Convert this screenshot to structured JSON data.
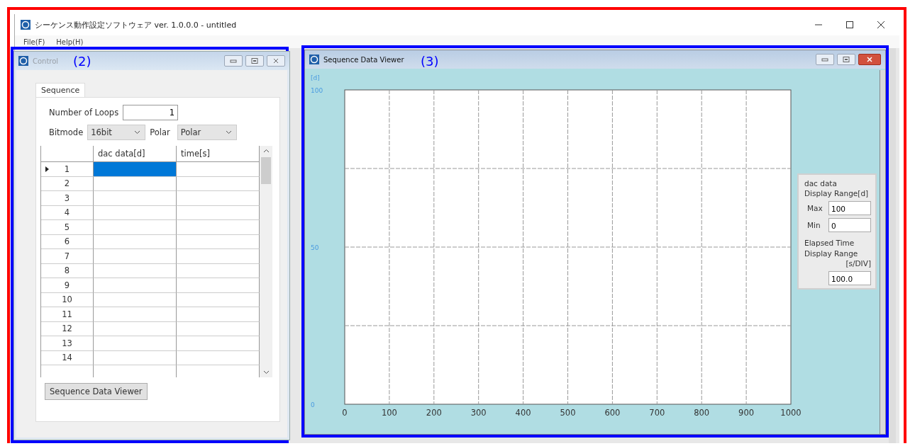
{
  "window": {
    "title": "シーケンス動作設定ソフトウェア ver. 1.0.0.0 - untitled"
  },
  "menu": [
    "File(F)",
    "Help(H)"
  ],
  "control": {
    "title": "Control",
    "active": false,
    "annotation": "(2)",
    "tabs": [
      {
        "label": "Sequence",
        "selected": true
      }
    ],
    "loops": {
      "label": "Number of Loops",
      "value": "1"
    },
    "bitmode": {
      "label": "Bitmode",
      "value": "16bit"
    },
    "polar": {
      "label": "Polar",
      "value": "Polar"
    },
    "table": {
      "columns": [
        "dac data[d]",
        "time[s]"
      ],
      "rows": [
        {
          "number": "1",
          "selected": true
        },
        {
          "number": "2",
          "selected": false
        },
        {
          "number": "3",
          "selected": false
        },
        {
          "number": "4",
          "selected": false
        },
        {
          "number": "5",
          "selected": false
        },
        {
          "number": "6",
          "selected": false
        },
        {
          "number": "7",
          "selected": false
        },
        {
          "number": "8",
          "selected": false
        },
        {
          "number": "9",
          "selected": false
        },
        {
          "number": "10",
          "selected": false
        },
        {
          "number": "11",
          "selected": false
        },
        {
          "number": "12",
          "selected": false
        },
        {
          "number": "13",
          "selected": false
        },
        {
          "number": "14",
          "selected": false
        }
      ]
    },
    "button": "Sequence Data Viewer"
  },
  "viewer": {
    "title": "Sequence Data Viewer",
    "active": true,
    "annotation": "(3)",
    "chart_data": {
      "type": "line",
      "ylabel": "[d]",
      "xlim": [
        0,
        1000
      ],
      "ylim": [
        0,
        100
      ],
      "xticks": [
        0,
        100,
        200,
        300,
        400,
        500,
        600,
        700,
        800,
        900,
        1000
      ],
      "yticks": [
        0,
        50,
        100
      ],
      "grid": true
    },
    "range_panel": {
      "dac_heading": [
        "dac data",
        "Display Range[d]"
      ],
      "max": {
        "label": "Max",
        "value": "100"
      },
      "min": {
        "label": "Min",
        "value": "0"
      },
      "time_heading": [
        "Elapsed Time",
        "Display Range",
        "[s/DIV]"
      ],
      "time_value": "100.0"
    }
  }
}
